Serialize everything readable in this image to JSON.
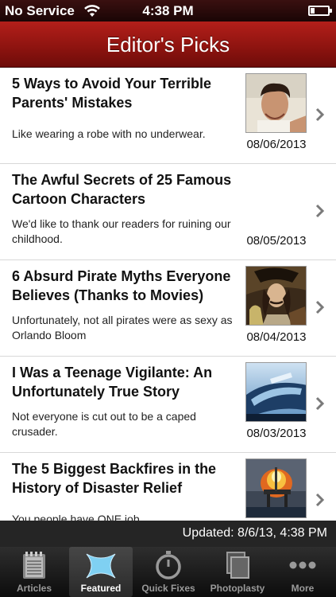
{
  "status_bar": {
    "carrier": "No Service",
    "time": "4:38 PM",
    "wifi_icon": "wifi-icon",
    "battery_icon": "battery-icon"
  },
  "nav": {
    "title": "Editor's Picks"
  },
  "articles": [
    {
      "title": "5 Ways to Avoid Your Terrible Parents' Mistakes",
      "description": "Like wearing a robe with no underwear.",
      "date": "08/06/2013",
      "thumbnail": "child-photo",
      "has_thumbnail": true
    },
    {
      "title": "The Awful Secrets of 25 Famous Cartoon Characters",
      "description": "We'd like to thank our readers for ruining our childhood.",
      "date": "08/05/2013",
      "thumbnail": "",
      "has_thumbnail": false
    },
    {
      "title": "6 Absurd Pirate Myths Everyone Believes (Thanks to Movies)",
      "description": "Unfortunately, not all pirates were as sexy as Orlando Bloom",
      "date": "08/04/2013",
      "thumbnail": "pirate-painting",
      "has_thumbnail": true
    },
    {
      "title": "I Was a Teenage Vigilante: An Unfortunately True Story",
      "description": "Not everyone is cut out to be a caped crusader.",
      "date": "08/03/2013",
      "thumbnail": "police-car-photo",
      "has_thumbnail": true
    },
    {
      "title": "The 5 Biggest Backfires in the History of Disaster Relief",
      "description": "You people have ONE job.",
      "date": "",
      "thumbnail": "oil-rig-fire-photo",
      "has_thumbnail": true
    }
  ],
  "updated_bar": {
    "text": "Updated: 8/6/13, 4:38 PM"
  },
  "tabs": [
    {
      "label": "Articles",
      "icon": "notepad-icon",
      "selected": false
    },
    {
      "label": "Featured",
      "icon": "featured-x-icon",
      "selected": true
    },
    {
      "label": "Quick Fixes",
      "icon": "stopwatch-icon",
      "selected": false
    },
    {
      "label": "Photoplasty",
      "icon": "photos-icon",
      "selected": false
    },
    {
      "label": "More",
      "icon": "more-dots-icon",
      "selected": false
    }
  ],
  "colors": {
    "nav_red": "#a01a15",
    "tab_bar": "#1a1a1a",
    "chevron": "#7a7a7a"
  }
}
